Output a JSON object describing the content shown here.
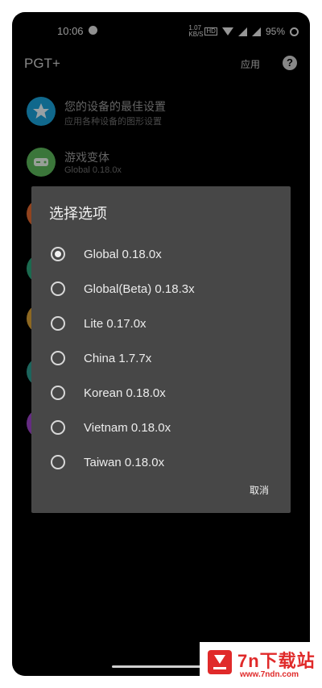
{
  "status_bar": {
    "time": "10:06",
    "net_rate": "1.07 KB/S",
    "sim": "HD",
    "battery": "95%"
  },
  "app_bar": {
    "title": "PGT+",
    "apply_label": "应用",
    "help_label": "?"
  },
  "list": {
    "items": [
      {
        "title": "您的设备的最佳设置",
        "subtitle": "应用各种设备的图形设置",
        "icon": "star-icon",
        "color": "#1aa0d8"
      },
      {
        "title": "游戏变体",
        "subtitle": "Global 0.18.0x",
        "icon": "gamepad-icon",
        "color": "#5bb55a"
      }
    ],
    "peek_colors": [
      "#e0672f",
      "#2aa37a",
      "#d9a033",
      "#2b9c8f",
      "#9b44c8"
    ]
  },
  "dialog": {
    "title": "选择选项",
    "selected_index": 0,
    "options": [
      "Global 0.18.0x",
      "Global(Beta) 0.18.3x",
      "Lite 0.17.0x",
      "China 1.7.7x",
      "Korean 0.18.0x",
      "Vietnam 0.18.0x",
      "Taiwan 0.18.0x"
    ],
    "cancel_label": "取消"
  },
  "watermark": {
    "name": "7n下载站",
    "url": "www.7ndn.com"
  }
}
